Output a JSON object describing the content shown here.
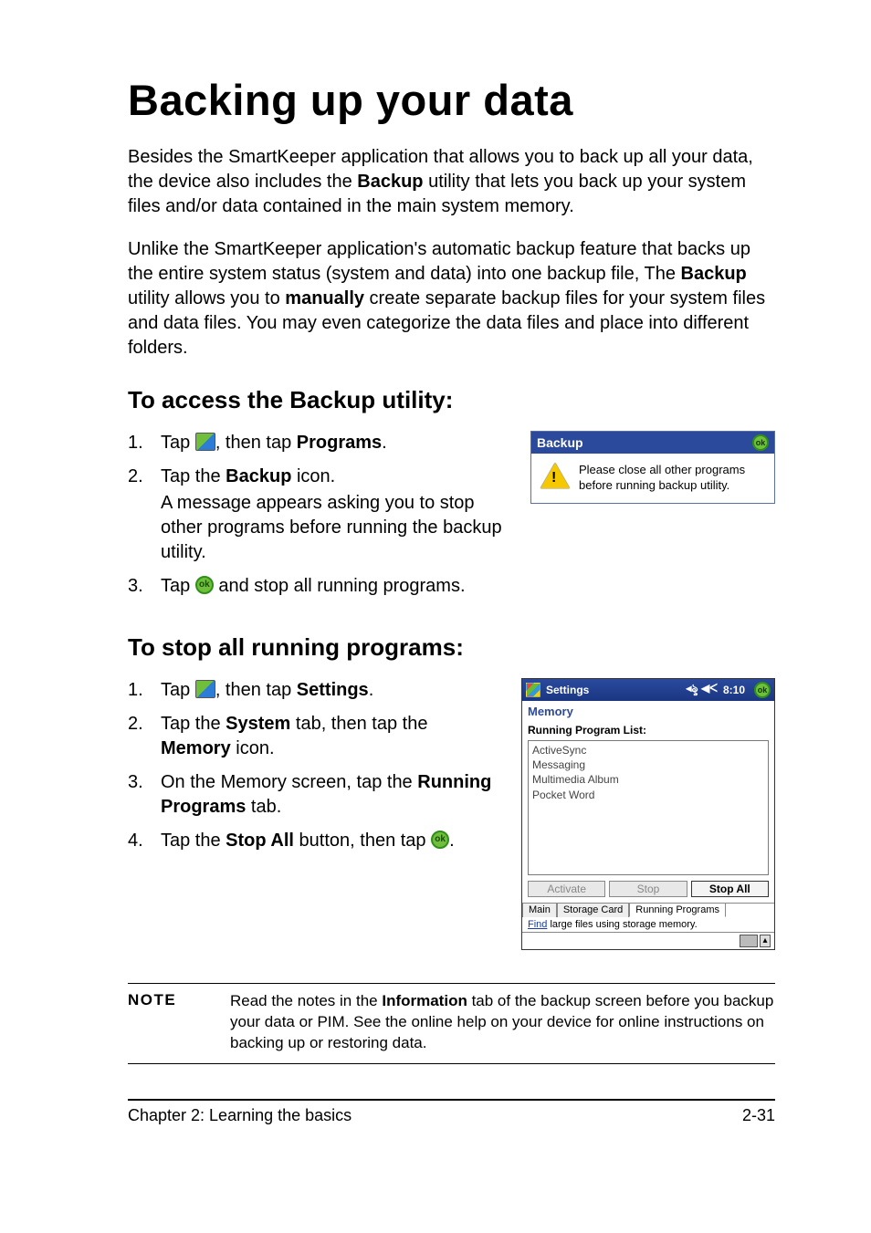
{
  "title": "Backing up your data",
  "p1": {
    "a": "Besides the SmartKeeper application that allows you to back up all your data, the device also includes the ",
    "b": "Backup",
    "c": " utility that lets you back up your system files and/or data contained in the main system memory."
  },
  "p2": {
    "a": "Unlike the SmartKeeper application's automatic backup feature that backs up the entire system status (system and data) into one backup file, The ",
    "b": "Backup",
    "c": " utility allows you to ",
    "d": "manually",
    "e": " create separate backup files for your system files and data files. You may even categorize the data files and place into different folders."
  },
  "h2a": "To access the Backup utility:",
  "accessSteps": {
    "s1a": "Tap ",
    "s1b": ", then tap ",
    "s1c": "Programs",
    "s1d": ".",
    "s2a": "Tap the ",
    "s2b": "Backup",
    "s2c": " icon.",
    "s2sub": "A message appears asking you to stop other programs before running the backup utility.",
    "s3a": "Tap ",
    "s3b": " and stop all running programs."
  },
  "dialog": {
    "title": "Backup",
    "ok": "ok",
    "msg": "Please close all other programs before running backup utility."
  },
  "h2b": "To stop all running programs:",
  "stopSteps": {
    "s1a": "Tap ",
    "s1b": ", then tap ",
    "s1c": "Settings",
    "s1d": ".",
    "s2a": "Tap the ",
    "s2b": "System",
    "s2c": " tab, then tap the ",
    "s2d": "Memory",
    "s2e": " icon.",
    "s3a": "On the Memory screen, tap the ",
    "s3b": "Running Programs",
    "s3c": " tab.",
    "s4a": "Tap the ",
    "s4b": "Stop All",
    "s4c": " button, then tap ",
    "s4d": "."
  },
  "shot": {
    "header": "Settings",
    "signal": "◂ৡ ◀ᐸ",
    "time": "8:10",
    "ok": "ok",
    "sub": "Memory",
    "listLabel": "Running Program List:",
    "items": [
      "ActiveSync",
      "Messaging",
      "Multimedia Album",
      "Pocket Word"
    ],
    "btnActivate": "Activate",
    "btnStop": "Stop",
    "btnStopAll": "Stop All",
    "tabs": [
      "Main",
      "Storage Card",
      "Running Programs"
    ],
    "findLnk": "Find",
    "findRest": " large files using storage memory.",
    "upGlyph": "▴"
  },
  "note": {
    "label": "NOTE",
    "a": "Read the notes in the ",
    "b": "Information",
    "c": " tab of the backup screen before you backup your data or PIM. See the online help on your device for online instructions on backing up or restoring data."
  },
  "footer": {
    "left": "Chapter 2: Learning the basics",
    "right": "2-31"
  },
  "okText": "ok"
}
